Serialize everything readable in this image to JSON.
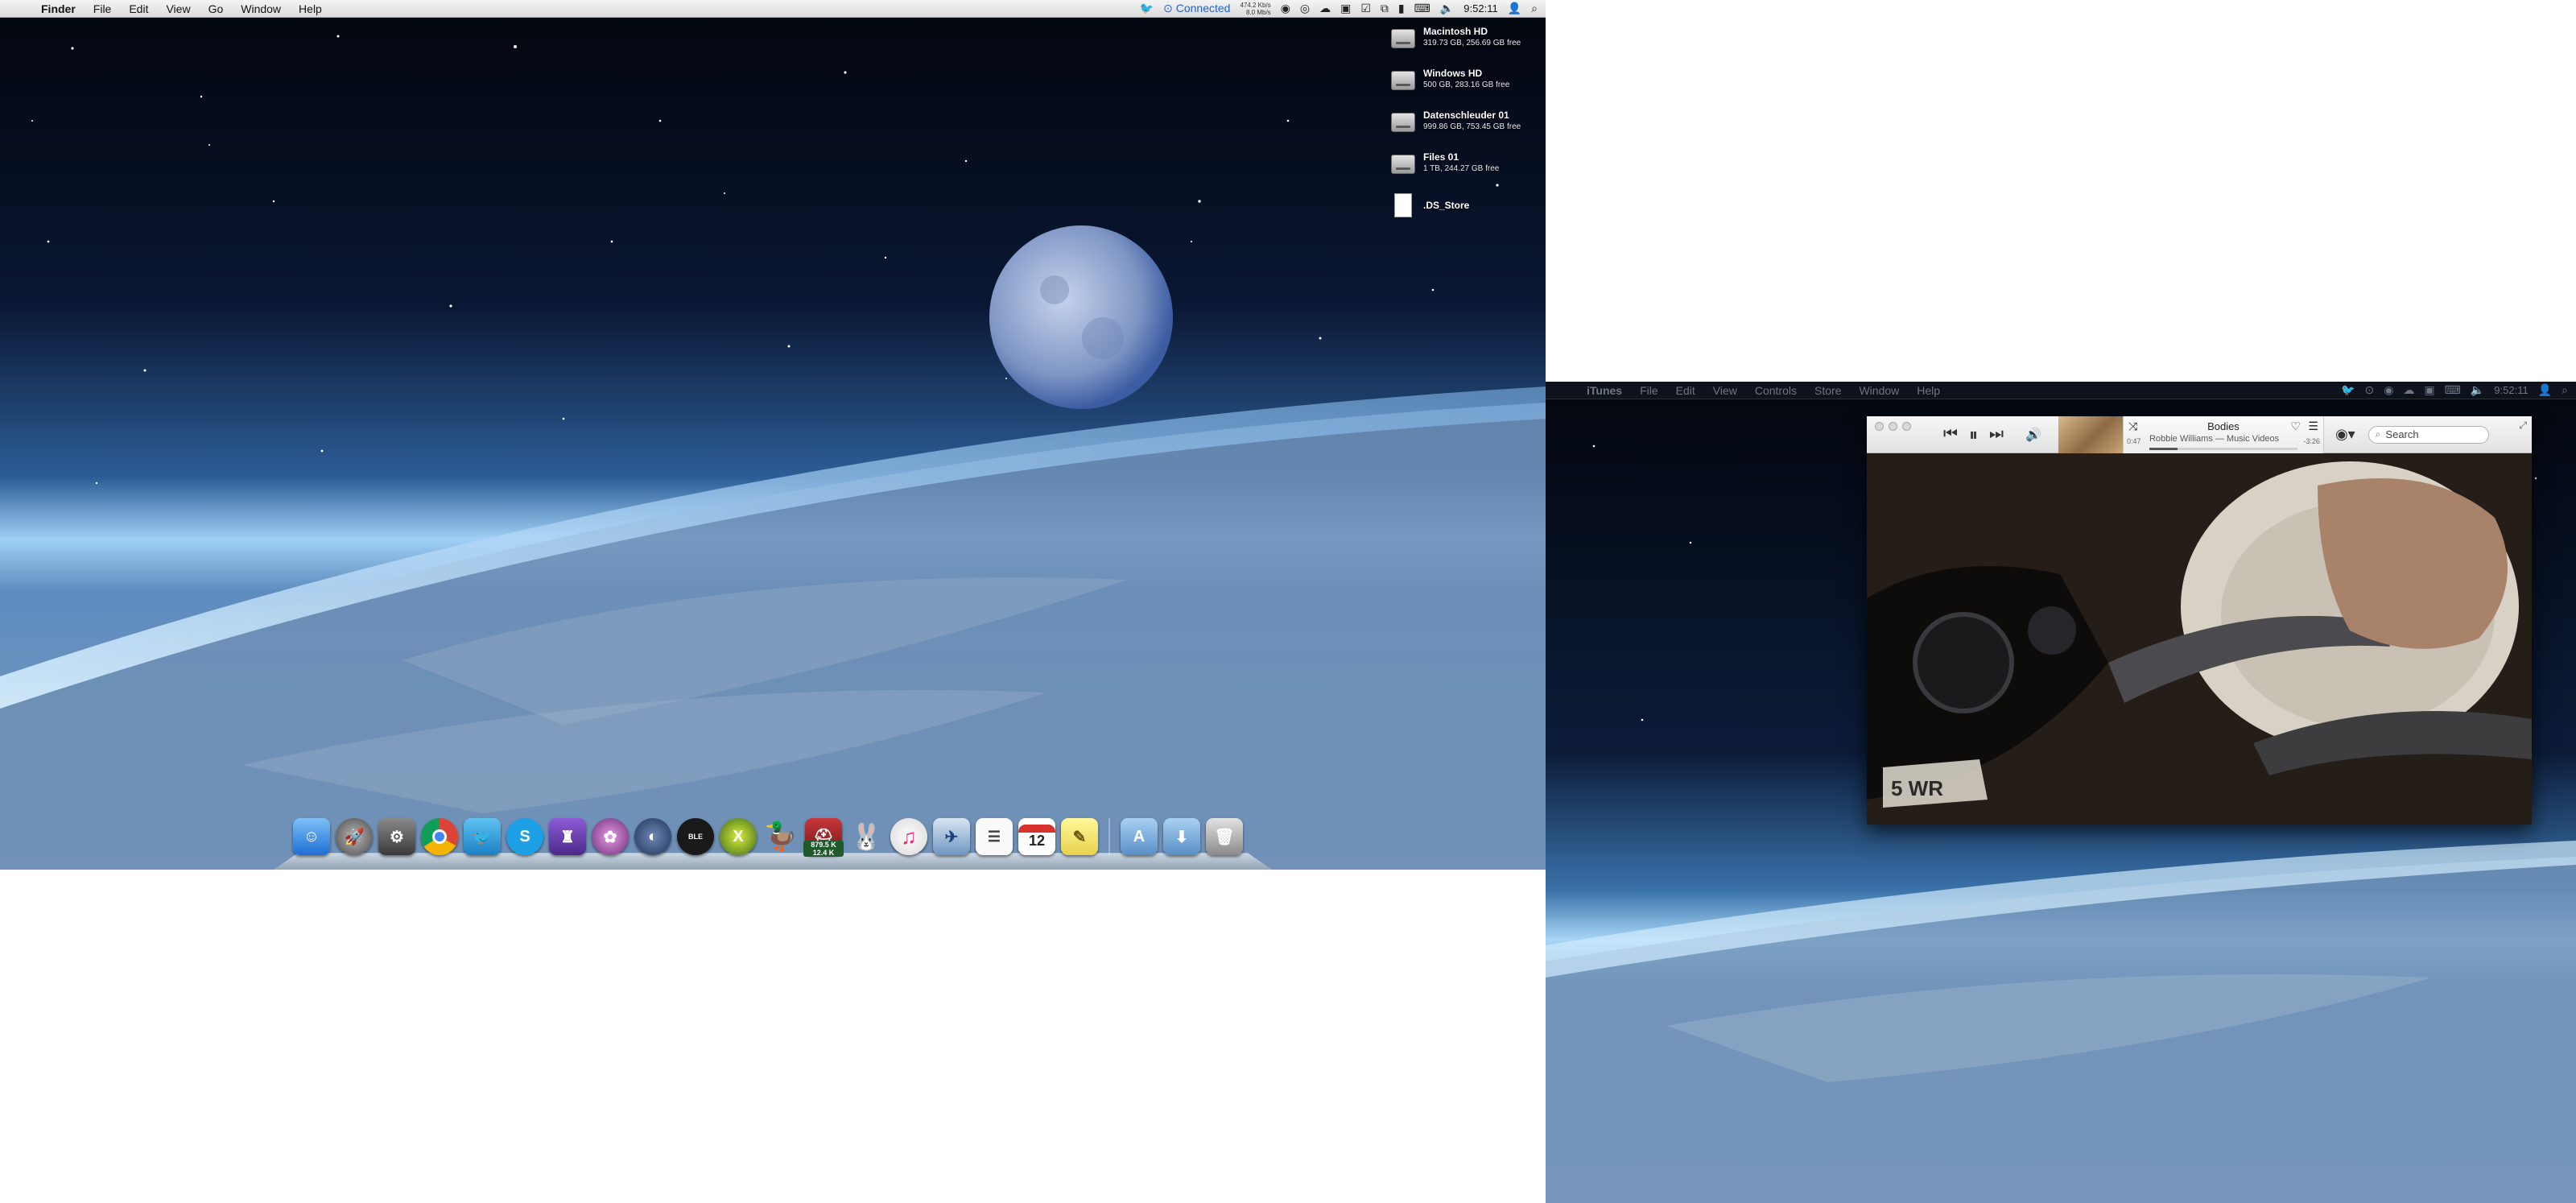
{
  "left_screen": {
    "menubar": {
      "apple": "",
      "items": [
        "Finder",
        "File",
        "Edit",
        "View",
        "Go",
        "Window",
        "Help"
      ],
      "status": {
        "connected": "Connected",
        "net_up": "474.2 Kb/s",
        "net_down": "8.0 Mb/s",
        "time": "9:52:11"
      }
    },
    "desktop_icons": [
      {
        "name": "Macintosh HD",
        "info": "319.73 GB, 256.69 GB free"
      },
      {
        "name": "Windows HD",
        "info": "500 GB, 283.16 GB free"
      },
      {
        "name": "Datenschleuder 01",
        "info": "999.86 GB, 753.45 GB free"
      },
      {
        "name": "Files 01",
        "info": "1 TB, 244.27 GB free"
      },
      {
        "name": ".DS_Store",
        "info": ""
      }
    ],
    "dock": {
      "speed_badge": [
        "879.5 K",
        "12.4 K"
      ],
      "calendar_day": "12"
    }
  },
  "right_screen": {
    "menubar": {
      "items": [
        "iTunes",
        "File",
        "Edit",
        "View",
        "Controls",
        "Store",
        "Window",
        "Help"
      ],
      "time": "9:52:11"
    },
    "itunes": {
      "song_title": "Bodies",
      "song_subtitle": "Robbie Williams — Music Videos",
      "elapsed": "0:47",
      "remaining": "-3:26",
      "progress": 0.19,
      "search_placeholder": "Search"
    }
  },
  "colors": {
    "menubar": "#e8e8e8",
    "accent_connected": "#2563c9",
    "sky_dark": "#040812",
    "horizon_glow": "#8fc3ee"
  }
}
